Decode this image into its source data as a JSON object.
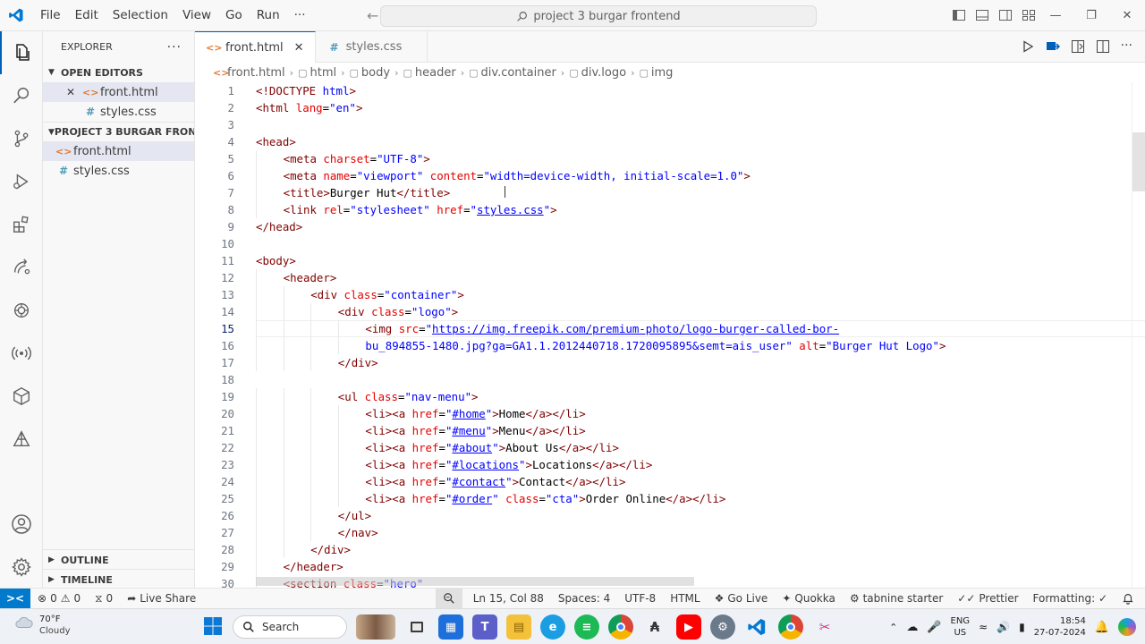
{
  "titlebar": {
    "menu": [
      "File",
      "Edit",
      "Selection",
      "View",
      "Go",
      "Run",
      "···"
    ],
    "search_text": "project 3 burgar frontend"
  },
  "sidebar": {
    "explorer_label": "EXPLORER",
    "open_editors_label": "OPEN EDITORS",
    "open_editors": [
      {
        "name": "front.html",
        "type": "html",
        "selected": true,
        "close": "✕"
      },
      {
        "name": "styles.css",
        "type": "css",
        "selected": false
      }
    ],
    "project_label": "PROJECT 3 BURGAR FRON...",
    "files": [
      {
        "name": "front.html",
        "type": "html",
        "selected": true
      },
      {
        "name": "styles.css",
        "type": "css",
        "selected": false
      }
    ],
    "outline_label": "OUTLINE",
    "timeline_label": "TIMELINE"
  },
  "tabs": [
    {
      "label": "front.html",
      "active": true,
      "type": "html"
    },
    {
      "label": "styles.css",
      "active": false,
      "type": "css"
    }
  ],
  "breadcrumb": [
    "front.html",
    "html",
    "body",
    "header",
    "div.container",
    "div.logo",
    "img"
  ],
  "code": {
    "line_numbers": [
      "1",
      "2",
      "3",
      "4",
      "5",
      "6",
      "7",
      "8",
      "9",
      "10",
      "11",
      "12",
      "13",
      "14",
      "15",
      "16",
      "17",
      "18",
      "19",
      "20",
      "21",
      "22",
      "23",
      "24",
      "25",
      "26",
      "27",
      "28",
      "29",
      "30"
    ],
    "current_line": "15"
  },
  "status": {
    "problems": "0",
    "warnings": "0",
    "ports": "0",
    "live_share": "Live Share",
    "position": "Ln 15, Col 88",
    "spaces": "Spaces: 4",
    "encoding": "UTF-8",
    "language": "HTML",
    "go_live": "Go Live",
    "quokka": "Quokka",
    "tabnine": "tabnine starter",
    "prettier": "Prettier",
    "formatting": "Formatting: ✓"
  },
  "taskbar": {
    "temperature": "70°F",
    "condition": "Cloudy",
    "search_label": "Search",
    "lang_top": "ENG",
    "lang_bottom": "US",
    "time": "18:54",
    "date": "27-07-2024"
  },
  "colors": {
    "accent": "#005fb8",
    "remote_bg": "#007acc",
    "tag": "#800000",
    "attribute": "#e50000",
    "string": "#0000ff"
  }
}
